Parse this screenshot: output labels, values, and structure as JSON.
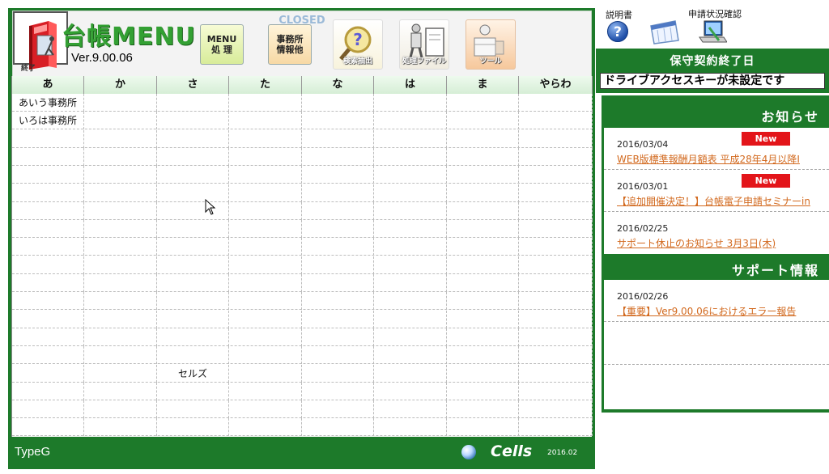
{
  "header": {
    "title": "台帳MENU",
    "version": "Ver.9.00.06"
  },
  "toolbar": {
    "menu_line1": "MENU",
    "menu_line2": "処 理",
    "office_line1": "事務所",
    "office_line2": "情報他",
    "search_label": "検索抽出",
    "file_label": "処理ファイル",
    "tool_label": "ツール",
    "closed_text": "CLOSED",
    "closed_label": "終了"
  },
  "grid": {
    "columns": [
      "あ",
      "か",
      "さ",
      "た",
      "な",
      "は",
      "ま",
      "やらわ"
    ],
    "rows": [
      [
        "あいう事務所",
        "",
        "",
        "",
        "",
        "",
        "",
        ""
      ],
      [
        "いろは事務所",
        "",
        "",
        "",
        "",
        "",
        "",
        ""
      ],
      [
        "",
        "",
        "",
        "",
        "",
        "",
        "",
        ""
      ],
      [
        "",
        "",
        "",
        "",
        "",
        "",
        "",
        ""
      ],
      [
        "",
        "",
        "",
        "",
        "",
        "",
        "",
        ""
      ],
      [
        "",
        "",
        "",
        "",
        "",
        "",
        "",
        ""
      ],
      [
        "",
        "",
        "",
        "",
        "",
        "",
        "",
        ""
      ],
      [
        "",
        "",
        "",
        "",
        "",
        "",
        "",
        ""
      ],
      [
        "",
        "",
        "",
        "",
        "",
        "",
        "",
        ""
      ],
      [
        "",
        "",
        "",
        "",
        "",
        "",
        "",
        ""
      ],
      [
        "",
        "",
        "",
        "",
        "",
        "",
        "",
        ""
      ],
      [
        "",
        "",
        "",
        "",
        "",
        "",
        "",
        ""
      ],
      [
        "",
        "",
        "",
        "",
        "",
        "",
        "",
        ""
      ],
      [
        "",
        "",
        "",
        "",
        "",
        "",
        "",
        ""
      ],
      [
        "",
        "",
        "",
        "",
        "",
        "",
        "",
        ""
      ],
      [
        "",
        "",
        "セルズ",
        "",
        "",
        "",
        "",
        ""
      ],
      [
        "",
        "",
        "",
        "",
        "",
        "",
        "",
        ""
      ],
      [
        "",
        "",
        "",
        "",
        "",
        "",
        "",
        ""
      ],
      [
        "",
        "",
        "",
        "",
        "",
        "",
        "",
        ""
      ]
    ]
  },
  "footer": {
    "type_label": "TypeG",
    "brand": "Cells",
    "build_date": "2016.02"
  },
  "side": {
    "manual_label": "説明書",
    "status_label": "申請状況確認",
    "contract_title": "保守契約終了日",
    "contract_value": "ドライブアクセスキーが未設定です",
    "news_title": "お知らせ",
    "news": [
      {
        "date": "2016/03/04",
        "text": "WEB版標準報酬月額表 平成28年4月以降I",
        "badge": "New"
      },
      {
        "date": "2016/03/01",
        "text": "【追加開催決定！】台帳電子申請セミナーin",
        "badge": "New"
      },
      {
        "date": "2016/02/25",
        "text": "サポート休止のお知らせ 3月3日(木)",
        "badge": ""
      }
    ],
    "support_title": "サポート情報",
    "support": [
      {
        "date": "2016/02/26",
        "text": "【重要】Ver9.00.06におけるエラー報告"
      }
    ]
  },
  "colors": {
    "frame_green": "#1d7a2a",
    "title_green": "#33a033",
    "new_badge_red": "#e3151a",
    "link_orange": "#d2691e"
  }
}
